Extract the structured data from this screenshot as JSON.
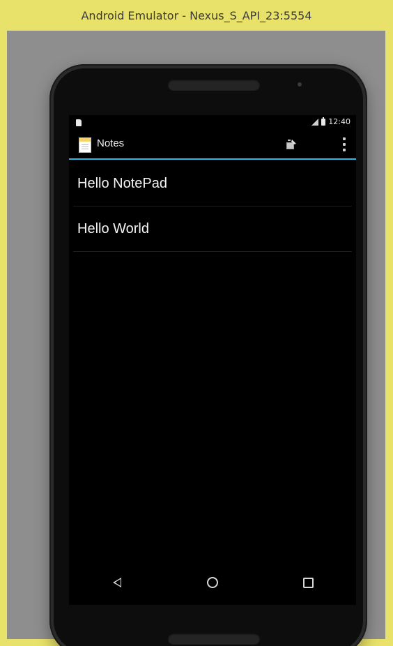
{
  "window": {
    "title": "Android Emulator - Nexus_S_API_23:5554"
  },
  "status_bar": {
    "time": "12:40",
    "icons": [
      "sd-card-icon",
      "signal-icon",
      "battery-icon"
    ]
  },
  "action_bar": {
    "title": "Notes",
    "app_icon": "notepad-icon",
    "actions": [
      "new-note-icon",
      "overflow-menu-icon"
    ],
    "accent_color": "#33b5e5"
  },
  "notes": {
    "items": [
      {
        "title": "Hello NotePad"
      },
      {
        "title": "Hello World"
      }
    ]
  },
  "navigation_bar": {
    "buttons": [
      "back-icon",
      "home-icon",
      "recents-icon"
    ]
  },
  "colors": {
    "window_frame": "#e9e26a",
    "screen_background": "#000000"
  }
}
